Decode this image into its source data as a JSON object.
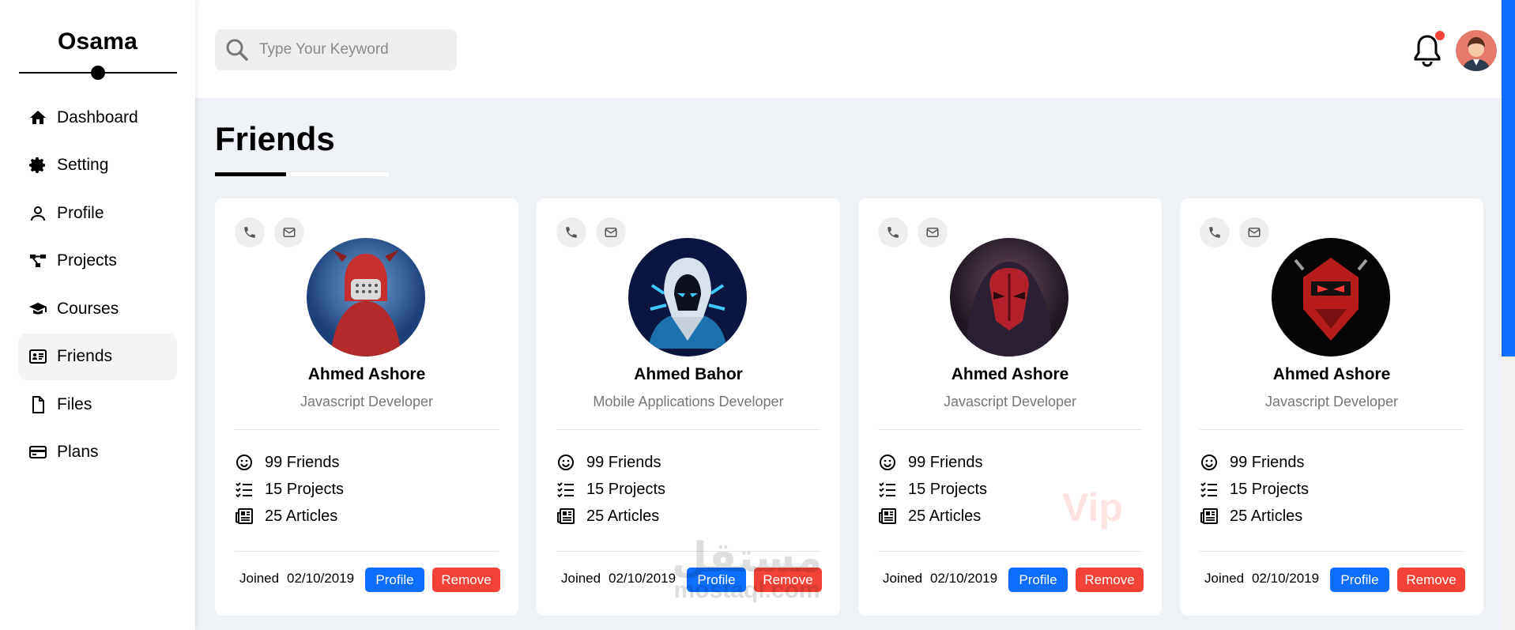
{
  "sidebar": {
    "brand": "Osama",
    "items": [
      {
        "label": "Dashboard",
        "icon": "home-icon"
      },
      {
        "label": "Setting",
        "icon": "gear-icon"
      },
      {
        "label": "Profile",
        "icon": "user-icon"
      },
      {
        "label": "Projects",
        "icon": "diagram-icon"
      },
      {
        "label": "Courses",
        "icon": "graduation-cap-icon"
      },
      {
        "label": "Friends",
        "icon": "address-card-icon",
        "active": true
      },
      {
        "label": "Files",
        "icon": "file-icon"
      },
      {
        "label": "Plans",
        "icon": "credit-card-icon"
      }
    ]
  },
  "header": {
    "search_placeholder": "Type Your Keyword",
    "notification_dot_color": "#f44336"
  },
  "page": {
    "title": "Friends"
  },
  "cards": [
    {
      "name": "Ahmed Ashore",
      "role": "Javascript Developer",
      "friends": "99 Friends",
      "projects": "15 Projects",
      "articles": "25 Articles",
      "joined_label": "Joined",
      "joined_date": "02/10/2019",
      "profile_label": "Profile",
      "remove_label": "Remove",
      "avatar_theme": "#c62f2f"
    },
    {
      "name": "Ahmed Bahor",
      "role": "Mobile Applications Developer",
      "friends": "99 Friends",
      "projects": "15 Projects",
      "articles": "25 Articles",
      "joined_label": "Joined",
      "joined_date": "02/10/2019",
      "profile_label": "Profile",
      "remove_label": "Remove",
      "avatar_theme": "#0a1640"
    },
    {
      "name": "Ahmed Ashore",
      "role": "Javascript Developer",
      "friends": "99 Friends",
      "projects": "15 Projects",
      "articles": "25 Articles",
      "joined_label": "Joined",
      "joined_date": "02/10/2019",
      "profile_label": "Profile",
      "remove_label": "Remove",
      "avatar_theme": "#3a2a3a",
      "badge": "Vip"
    },
    {
      "name": "Ahmed Ashore",
      "role": "Javascript Developer",
      "friends": "99 Friends",
      "projects": "15 Projects",
      "articles": "25 Articles",
      "joined_label": "Joined",
      "joined_date": "02/10/2019",
      "profile_label": "Profile",
      "remove_label": "Remove",
      "avatar_theme": "#000000"
    }
  ],
  "watermark": {
    "arabic": "مستقل",
    "latin": "mostaql.com"
  },
  "colors": {
    "primary": "#0d6efd",
    "danger": "#f44336",
    "background": "#eef1f5"
  }
}
